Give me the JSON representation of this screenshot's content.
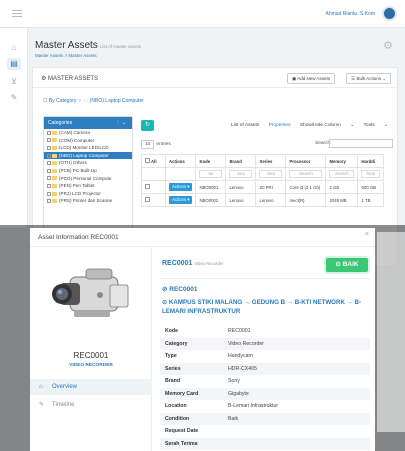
{
  "topbar": {
    "user_name": "Ahmad Riantu, S.Kom"
  },
  "page": {
    "title": "Master Assets",
    "subtitle": "List of master assets",
    "breadcrumb": "Master Assets > Master Assets"
  },
  "card": {
    "title": "MASTER ASSETS",
    "add_label": "Add New Assets",
    "bulk_label": "Bulk Actions",
    "by_category": "By Category",
    "current_category": "(NBO) Laptop Computer"
  },
  "categories": {
    "header": "Categories",
    "items": [
      "(CAM) Camera",
      "(COM) Computer",
      "(LCD) Monitor LED/LCD",
      "(NBO) Laptop Computer",
      "(OTH) Others",
      "(PCB) PC Built-Up",
      "(PCO) Personal Compute",
      "(PEN) Pen Tablet",
      "(PRJ) LCD Projector",
      "(PRS) Printer dan Scanne"
    ],
    "selected_index": 3
  },
  "table_toolbar": {
    "tabs": [
      "List of Assets",
      "Properties",
      "Show/Hide Column",
      "Tools"
    ],
    "page_size": "10",
    "entries_label": "entries",
    "search_label": "Search:"
  },
  "table": {
    "headers": [
      "All",
      "Actions",
      "Kode",
      "Brand",
      "Series",
      "Processor",
      "Memory",
      "Harddi"
    ],
    "filters": [
      "Se",
      "Sea",
      "Sea",
      "Search",
      "Search",
      "Sear"
    ],
    "rows": [
      {
        "action": "Actions",
        "kode": "NBO0001",
        "brand": "Lenovo",
        "series": "Z0 PRI",
        "processor": "Core i3 (2.1 Gh)",
        "memory": "2 GB",
        "harddisk": "500 GB"
      },
      {
        "action": "Actions",
        "kode": "NBO0002",
        "brand": "Lenovo",
        "series": "Lenovo",
        "processor": "mecl(R)",
        "memory": "2048 MB",
        "harddisk": "1 TB"
      }
    ]
  },
  "modal": {
    "title": "Asset Information REC0001",
    "asset_code": "REC0001",
    "asset_type": "VIDEO RECORDER",
    "header_subtitle": "Video Recorder",
    "status": "BAIK",
    "location": "KAMPUS STIKI MALANG → GEDUNG B → B-KTI NETWORK → B-LEMARI INFRASTRUKTUR",
    "nav": [
      "Overview",
      "Timeline"
    ],
    "details": [
      {
        "k": "Kode",
        "v": "REC0001"
      },
      {
        "k": "Category",
        "v": "Video Recorder"
      },
      {
        "k": "Type",
        "v": "Handycam"
      },
      {
        "k": "Series",
        "v": "HDR-CX405"
      },
      {
        "k": "Brand",
        "v": "Sony"
      },
      {
        "k": "Memory Card",
        "v": "Gigabyte"
      },
      {
        "k": "Location",
        "v": "B-Lemari Infrastruktur"
      },
      {
        "k": "Condition",
        "v": "Baik"
      },
      {
        "k": "Request Date",
        "v": ""
      },
      {
        "k": "Serah Terima",
        "v": ""
      }
    ]
  }
}
